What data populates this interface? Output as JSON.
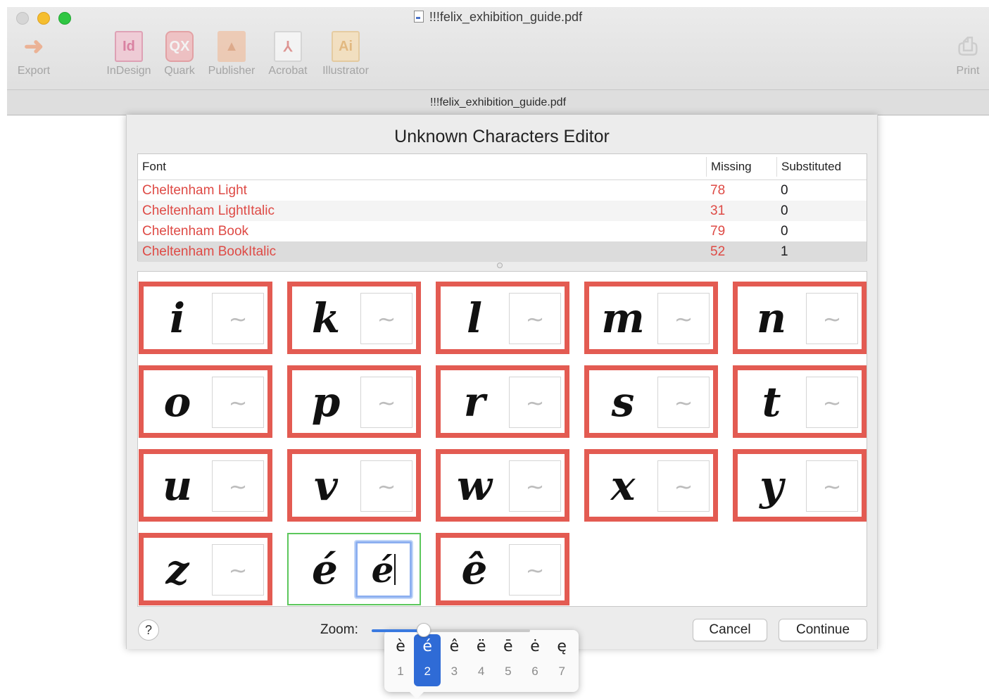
{
  "window": {
    "title": "!!!felix_exhibition_guide.pdf",
    "tab_title": "!!!felix_exhibition_guide.pdf"
  },
  "toolbar": [
    {
      "label": "Export",
      "icon": "export-arrow-icon"
    },
    {
      "label": "InDesign",
      "icon": "indesign-icon"
    },
    {
      "label": "Quark",
      "icon": "quark-icon"
    },
    {
      "label": "Publisher",
      "icon": "publisher-icon"
    },
    {
      "label": "Acrobat",
      "icon": "acrobat-icon"
    },
    {
      "label": "Illustrator",
      "icon": "illustrator-icon"
    },
    {
      "label": "Print",
      "icon": "printer-icon"
    }
  ],
  "dialog": {
    "title": "Unknown Characters Editor",
    "columns": {
      "font": "Font",
      "missing": "Missing",
      "substituted": "Substituted"
    },
    "fonts": [
      {
        "name": "Cheltenham Light",
        "missing": "78",
        "substituted": "0"
      },
      {
        "name": "Cheltenham LightItalic",
        "missing": "31",
        "substituted": "0"
      },
      {
        "name": "Cheltenham Book",
        "missing": "79",
        "substituted": "0"
      },
      {
        "name": "Cheltenham BookItalic",
        "missing": "52",
        "substituted": "1"
      }
    ],
    "selected_font_index": 3,
    "glyphs": [
      {
        "char": "i",
        "sub": "~"
      },
      {
        "char": "k",
        "sub": "~"
      },
      {
        "char": "l",
        "sub": "~"
      },
      {
        "char": "m",
        "sub": "~"
      },
      {
        "char": "n",
        "sub": "~"
      },
      {
        "char": "o",
        "sub": "~"
      },
      {
        "char": "p",
        "sub": "~"
      },
      {
        "char": "r",
        "sub": "~"
      },
      {
        "char": "s",
        "sub": "~"
      },
      {
        "char": "t",
        "sub": "~"
      },
      {
        "char": "u",
        "sub": "~"
      },
      {
        "char": "v",
        "sub": "~"
      },
      {
        "char": "w",
        "sub": "~"
      },
      {
        "char": "x",
        "sub": "~"
      },
      {
        "char": "y",
        "sub": "~"
      },
      {
        "char": "z",
        "sub": "~"
      },
      {
        "char": "é",
        "sub": "é",
        "done": true
      },
      {
        "char": "ê",
        "sub": "~"
      }
    ],
    "accent_popup": {
      "options": [
        {
          "char": "è",
          "num": "1"
        },
        {
          "char": "é",
          "num": "2"
        },
        {
          "char": "ê",
          "num": "3"
        },
        {
          "char": "ë",
          "num": "4"
        },
        {
          "char": "ē",
          "num": "5"
        },
        {
          "char": "ė",
          "num": "6"
        },
        {
          "char": "ę",
          "num": "7"
        }
      ],
      "selected_index": 1
    },
    "help_label": "?",
    "zoom_label": "Zoom:",
    "zoom_level": 0.33,
    "cancel_label": "Cancel",
    "continue_label": "Continue"
  },
  "colors": {
    "missing_border": "#e35b52",
    "resolved_border": "#5cc75c",
    "accent_blue": "#2f6bd6",
    "missing_text": "#de4a45"
  }
}
